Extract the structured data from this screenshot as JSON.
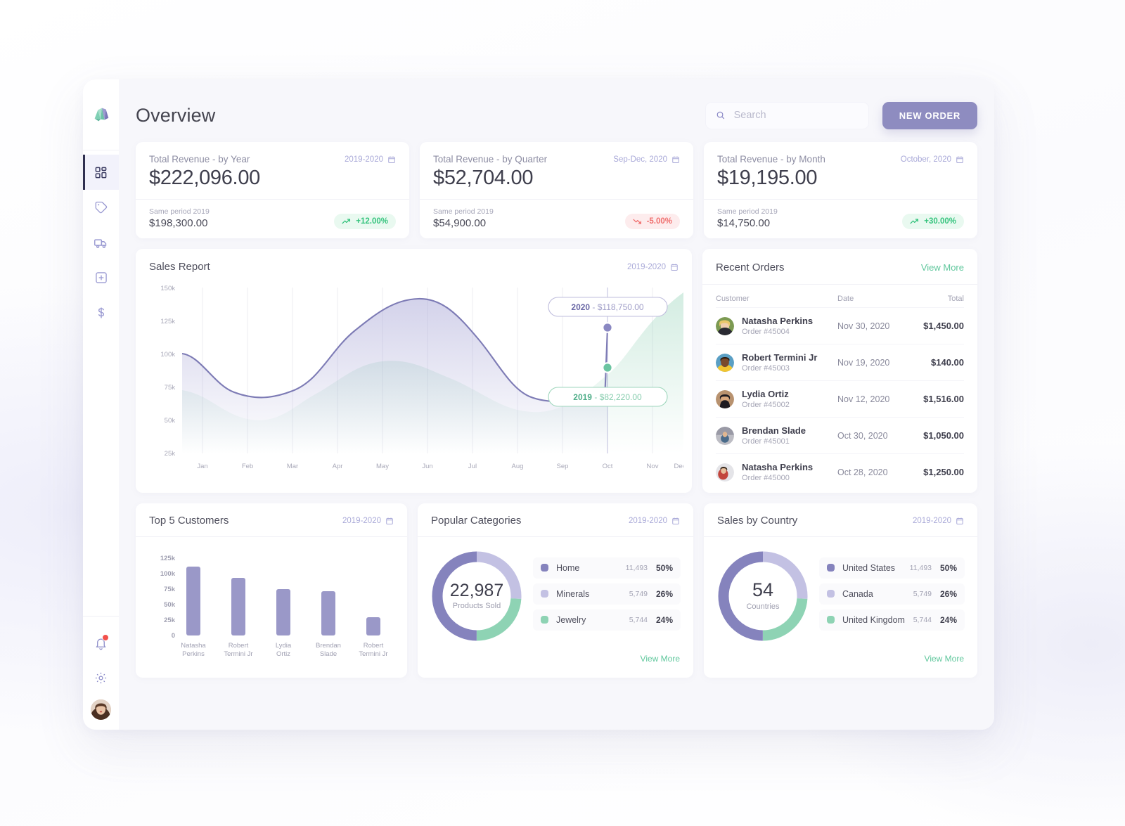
{
  "header": {
    "title": "Overview",
    "search_placeholder": "Search",
    "search_value": "",
    "new_order_label": "NEW ORDER"
  },
  "sidebar": {
    "items": [
      {
        "name": "dashboard",
        "label": "Dashboard",
        "active": true
      },
      {
        "name": "tag",
        "label": "Products",
        "active": false
      },
      {
        "name": "truck",
        "label": "Shipping",
        "active": false
      },
      {
        "name": "plus-box",
        "label": "Add",
        "active": false
      },
      {
        "name": "dollar",
        "label": "Billing",
        "active": false
      }
    ],
    "bottom": [
      {
        "name": "bell",
        "label": "Notifications",
        "badge": true
      },
      {
        "name": "gear",
        "label": "Settings",
        "badge": false
      }
    ]
  },
  "stats": [
    {
      "label": "Total Revenue - by Year",
      "period": "2019-2020",
      "value": "$222,096.00",
      "sub_label": "Same period 2019",
      "sub_value": "$198,300.00",
      "delta": "+12.00%",
      "direction": "up"
    },
    {
      "label": "Total Revenue - by Quarter",
      "period": "Sep-Dec, 2020",
      "value": "$52,704.00",
      "sub_label": "Same period 2019",
      "sub_value": "$54,900.00",
      "delta": "-5.00%",
      "direction": "down"
    },
    {
      "label": "Total Revenue - by Month",
      "period": "October, 2020",
      "value": "$19,195.00",
      "sub_label": "Same period 2019",
      "sub_value": "$14,750.00",
      "delta": "+30.00%",
      "direction": "up"
    }
  ],
  "sales_report": {
    "title": "Sales Report",
    "period": "2019-2020",
    "tooltip_2020": "2020 - $118,750.00",
    "tooltip_2019": "2019 - $82,220.00"
  },
  "orders": {
    "title": "Recent Orders",
    "view_more": "View More",
    "columns": [
      "Customer",
      "Date",
      "Total"
    ],
    "rows": [
      {
        "name": "Natasha Perkins",
        "order": "Order #45004",
        "date": "Nov 30, 2020",
        "total": "$1,450.00",
        "avatar": "#9ab06a"
      },
      {
        "name": "Robert Termini Jr",
        "order": "Order #45003",
        "date": "Nov 19, 2020",
        "total": "$140.00",
        "avatar": "#5a9fc4"
      },
      {
        "name": "Lydia Ortiz",
        "order": "Order #45002",
        "date": "Nov 12, 2020",
        "total": "$1,516.00",
        "avatar": "#b08a6e"
      },
      {
        "name": "Brendan Slade",
        "order": "Order #45001",
        "date": "Oct 30, 2020",
        "total": "$1,050.00",
        "avatar": "#9a9aa6"
      },
      {
        "name": "Natasha Perkins",
        "order": "Order #45000",
        "date": "Oct 28, 2020",
        "total": "$1,250.00",
        "avatar": "#d2d2d8"
      }
    ]
  },
  "top_customers": {
    "title": "Top 5 Customers",
    "period": "2019-2020"
  },
  "categories": {
    "title": "Popular Categories",
    "period": "2019-2020",
    "center_value": "22,987",
    "center_label": "Products Sold",
    "view_more": "View More",
    "items": [
      {
        "label": "Home",
        "count": "11,493",
        "pct": "50%",
        "color": "#8583bd"
      },
      {
        "label": "Minerals",
        "count": "5,749",
        "pct": "26%",
        "color": "#c3c1e3"
      },
      {
        "label": "Jewelry",
        "count": "5,744",
        "pct": "24%",
        "color": "#8ed3b4"
      }
    ]
  },
  "countries": {
    "title": "Sales by Country",
    "period": "2019-2020",
    "center_value": "54",
    "center_label": "Countries",
    "view_more": "View More",
    "items": [
      {
        "label": "United States",
        "count": "11,493",
        "pct": "50%",
        "color": "#8583bd"
      },
      {
        "label": "Canada",
        "count": "5,749",
        "pct": "26%",
        "color": "#c3c1e3"
      },
      {
        "label": "United Kingdom",
        "count": "5,744",
        "pct": "24%",
        "color": "#8ed3b4"
      }
    ]
  },
  "colors": {
    "accent_purple": "#8e8cc0",
    "accent_green": "#5fc79c",
    "up_green": "#36c47e",
    "down_red": "#f0706f"
  },
  "chart_data": [
    {
      "type": "line",
      "title": "Sales Report",
      "xlabel": "",
      "ylabel": "",
      "grid": true,
      "legend": "annotations",
      "categories": [
        "Jan",
        "Feb",
        "Mar",
        "Apr",
        "May",
        "Jun",
        "Jul",
        "Aug",
        "Sep",
        "Oct",
        "Nov",
        "Dec"
      ],
      "ytick_labels": [
        "25k",
        "50k",
        "75k",
        "100k",
        "125k",
        "150k"
      ],
      "ylim": [
        25000,
        150000
      ],
      "series": [
        {
          "name": "2020",
          "color": "#7d7bb5",
          "values": [
            100000,
            70000,
            67000,
            95000,
            125000,
            137000,
            128000,
            88000,
            70000,
            118750,
            null,
            null
          ]
        },
        {
          "name": "2019",
          "color": "#8ed3b4",
          "values": [
            74000,
            58000,
            46000,
            55000,
            78000,
            97000,
            92000,
            70000,
            60000,
            82220,
            110000,
            140000
          ]
        }
      ],
      "annotations": [
        {
          "text": "2020 - $118,750.00",
          "x": "Oct",
          "y": 118750,
          "color": "#7d7bb5"
        },
        {
          "text": "2019 - $82,220.00",
          "x": "Oct",
          "y": 82220,
          "color": "#5fc79c"
        }
      ]
    },
    {
      "type": "bar",
      "title": "Top 5 Customers",
      "categories": [
        "Natasha Perkins",
        "Robert Termini Jr",
        "Lydia Ortiz",
        "Brendan Slade",
        "Robert Termini Jr"
      ],
      "values": [
        111000,
        93000,
        75000,
        71000,
        30000
      ],
      "ytick_labels": [
        "0",
        "25k",
        "50k",
        "75k",
        "100k",
        "125k"
      ],
      "ylim": [
        0,
        125000
      ],
      "color": "#9a98c8",
      "xlabel": "",
      "ylabel": ""
    },
    {
      "type": "pie",
      "title": "Popular Categories",
      "center_value": "22,987",
      "center_label": "Products Sold",
      "labels": [
        "Minerals",
        "Jewelry",
        "Home"
      ],
      "values": [
        26,
        24,
        50
      ],
      "counts": [
        "5,749",
        "5,744",
        "11,493"
      ],
      "colors": [
        "#c3c1e3",
        "#8ed3b4",
        "#8583bd"
      ]
    },
    {
      "type": "pie",
      "title": "Sales by Country",
      "center_value": "54",
      "center_label": "Countries",
      "labels": [
        "Canada",
        "United Kingdom",
        "United States"
      ],
      "values": [
        26,
        24,
        50
      ],
      "counts": [
        "5,749",
        "5,744",
        "11,493"
      ],
      "colors": [
        "#c3c1e3",
        "#8ed3b4",
        "#8583bd"
      ]
    }
  ]
}
